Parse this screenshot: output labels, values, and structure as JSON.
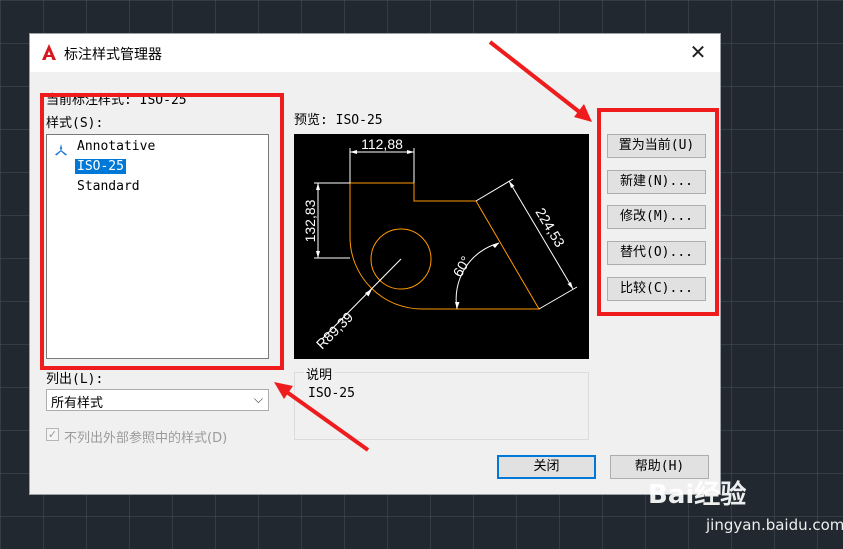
{
  "window": {
    "title": "标注样式管理器",
    "close_glyph": "✕"
  },
  "left_panel": {
    "current_style_label": "当前标注样式: ISO-25",
    "styles_label": "样式(S):",
    "styles": [
      {
        "name": "Annotative",
        "icon": "annotative-icon",
        "selected": false
      },
      {
        "name": "ISO-25",
        "icon": "",
        "selected": true
      },
      {
        "name": "Standard",
        "icon": "",
        "selected": false
      }
    ],
    "list_label": "列出(L):",
    "list_value": "所有样式",
    "xref_checkbox_label": "不列出外部参照中的样式(D)",
    "xref_checked": true
  },
  "preview": {
    "label": "预览: ISO-25",
    "dimensions": {
      "horizontal": "112,88",
      "vertical": "132,83",
      "aligned": "224,53",
      "angle": "60°",
      "radius": "R89,39"
    },
    "geometry_color": "#ff9900",
    "dimension_color": "#ffffff"
  },
  "description": {
    "label": "说明",
    "text": "ISO-25"
  },
  "buttons": {
    "set_current": "置为当前(U)",
    "new": "新建(N)...",
    "modify": "修改(M)...",
    "override": "替代(O)...",
    "compare": "比较(C)...",
    "close": "关闭",
    "help": "帮助(H)"
  },
  "watermark": {
    "logo_text": "Bai经验",
    "url": "jingyan.baidu.com"
  },
  "colors": {
    "highlight": "#ee1c1c",
    "selection": "#0078d7"
  }
}
